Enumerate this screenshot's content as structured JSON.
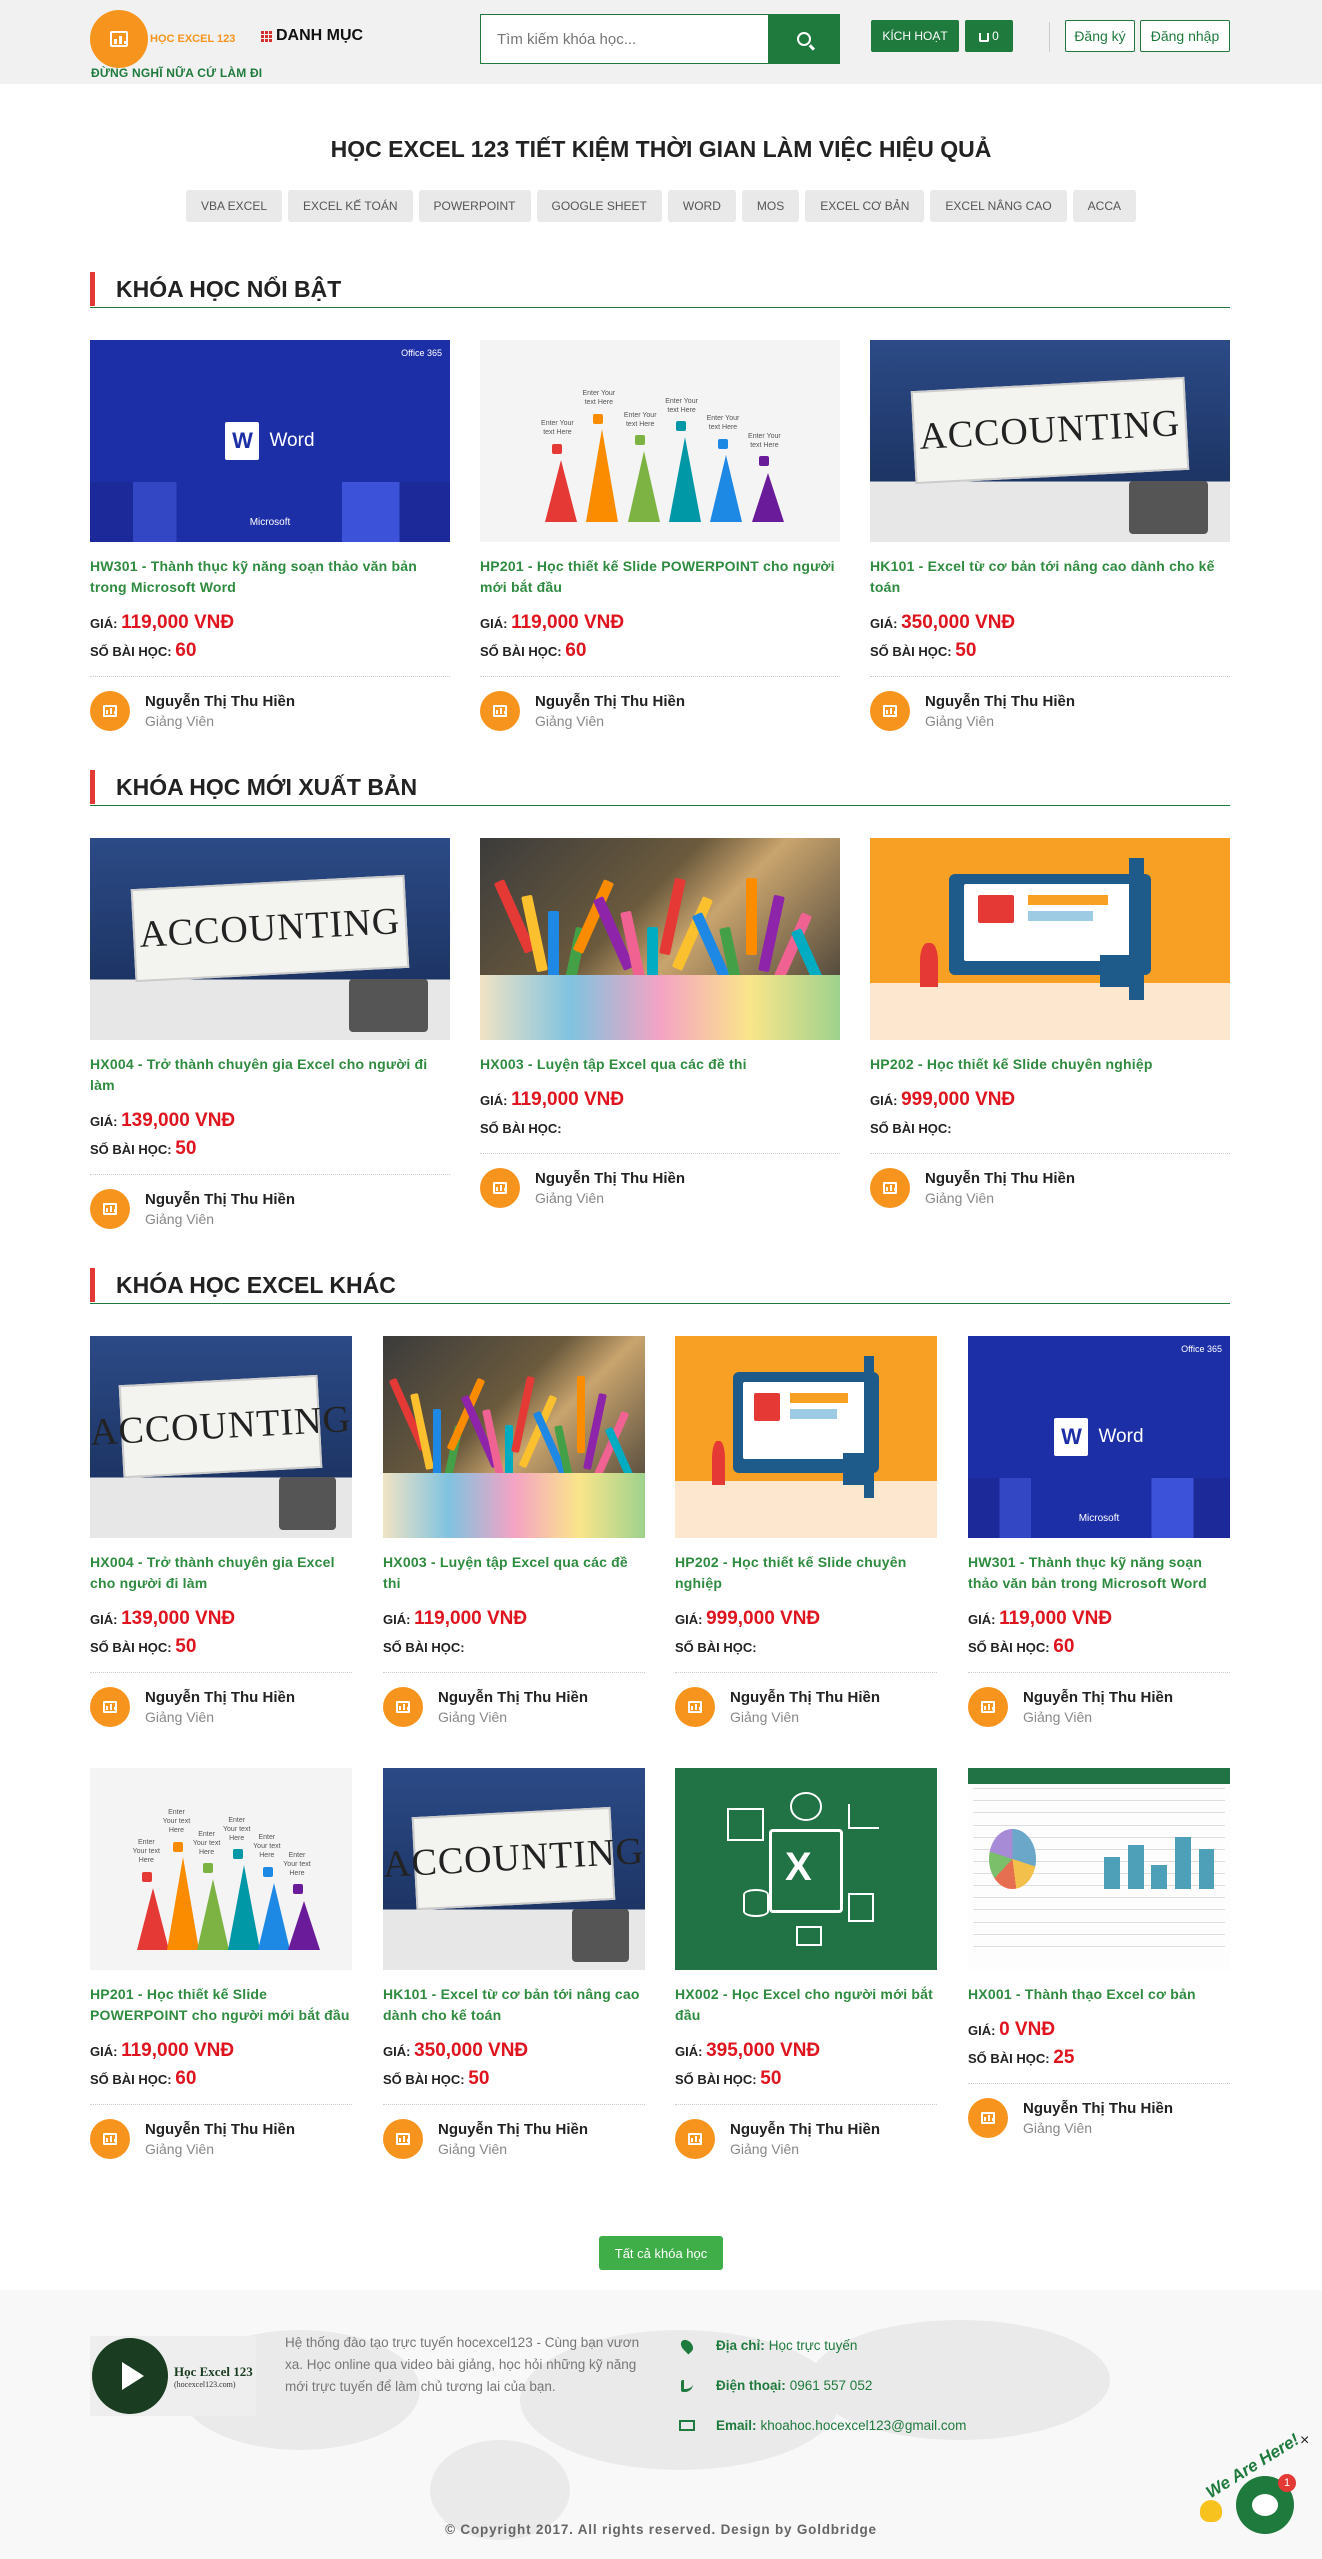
{
  "header": {
    "logo_text": "HỌC EXCEL 123",
    "slogan": "ĐỪNG NGHĨ NỮA CỨ LÀM ĐI",
    "menu_label": "DANH MỤC",
    "search_placeholder": "Tìm kiếm khóa học...",
    "activate_label": "KÍCH HOẠT",
    "cart_count": "0",
    "register_label": "Đăng ký",
    "login_label": "Đăng nhập"
  },
  "hero": {
    "title": "HỌC EXCEL 123 TIẾT KIỆM THỜI GIAN LÀM VIỆC HIỆU QUẢ",
    "tags": [
      "VBA EXCEL",
      "EXCEL KẾ TOÁN",
      "POWERPOINT",
      "GOOGLE SHEET",
      "WORD",
      "MOS",
      "EXCEL CƠ BẢN",
      "EXCEL NÂNG CAO",
      "ACCA"
    ]
  },
  "labels": {
    "price": "GIÁ:",
    "lessons": "SỐ BÀI HỌC:",
    "role": "Giảng Viên",
    "teacher": "Nguyễn Thị Thu Hiền"
  },
  "sections": [
    {
      "title": "KHÓA HỌC NỔI BẬT",
      "courses": [
        {
          "thumb": "word",
          "title": "HW301 - Thành thục kỹ năng soạn thảo văn bản trong Microsoft Word",
          "price": "119,000 VNĐ",
          "lessons": "60"
        },
        {
          "thumb": "bright",
          "title": "HP201 - Học thiết kế Slide POWERPOINT cho người mới bắt đầu",
          "price": "119,000 VNĐ",
          "lessons": "60"
        },
        {
          "thumb": "accounting",
          "title": "HK101 - Excel từ cơ bản tới nâng cao dành cho kế toán",
          "price": "350,000 VNĐ",
          "lessons": "50"
        }
      ]
    },
    {
      "title": "KHÓA HỌC MỚI XUẤT BẢN",
      "courses": [
        {
          "thumb": "accounting",
          "title": "HX004 - Trở thành chuyên gia Excel cho người đi làm",
          "price": "139,000 VNĐ",
          "lessons": "50"
        },
        {
          "thumb": "desk",
          "title": "HX003 - Luyện tập Excel qua các đề thi",
          "price": "119,000 VNĐ",
          "lessons": ""
        },
        {
          "thumb": "slide",
          "title": "HP202 - Học thiết kế Slide chuyên nghiệp",
          "price": "999,000 VNĐ",
          "lessons": ""
        }
      ]
    },
    {
      "title": "KHÓA HỌC EXCEL KHÁC",
      "courses": [
        {
          "thumb": "accounting",
          "title": "HX004 - Trở thành chuyên gia Excel cho người đi làm",
          "price": "139,000 VNĐ",
          "lessons": "50"
        },
        {
          "thumb": "desk",
          "title": "HX003 - Luyện tập Excel qua các đề thi",
          "price": "119,000 VNĐ",
          "lessons": ""
        },
        {
          "thumb": "slide",
          "title": "HP202 - Học thiết kế Slide chuyên nghiệp",
          "price": "999,000 VNĐ",
          "lessons": ""
        },
        {
          "thumb": "word",
          "title": "HW301 - Thành thục kỹ năng soạn thảo văn bản trong Microsoft Word",
          "price": "119,000 VNĐ",
          "lessons": "60"
        },
        {
          "thumb": "bright",
          "title": "HP201 - Học thiết kế Slide POWERPOINT cho người mới bắt đầu",
          "price": "119,000 VNĐ",
          "lessons": "60"
        },
        {
          "thumb": "accounting",
          "title": "HK101 - Excel từ cơ bản tới nâng cao dành cho kế toán",
          "price": "350,000 VNĐ",
          "lessons": "50"
        },
        {
          "thumb": "excel",
          "title": "HX002 - Học Excel cho người mới bắt đầu",
          "price": "395,000 VNĐ",
          "lessons": "50"
        },
        {
          "thumb": "sheet",
          "title": "HX001 - Thành thạo Excel cơ bản",
          "price": "0 VNĐ",
          "lessons": "25"
        }
      ]
    }
  ],
  "thumb_text": {
    "accounting": "ACCOUNTING",
    "word": "Word",
    "microsoft": "Microsoft",
    "office365": "Office 365",
    "enter_text": "Enter Your text Here"
  },
  "all_courses_label": "Tất cả khóa học",
  "footer": {
    "logo_text": "Học Excel 123",
    "logo_sub": "(hocexcel123.com)",
    "description": "Hệ thống đào tạo trực tuyến hocexcel123 - Cùng bạn vươn xa. Học online qua video bài giảng, học hỏi những kỹ năng mới trực tuyến để làm chủ tương lai của bạn.",
    "address_label": "Địa chỉ:",
    "address": "Học trực tuyến",
    "phone_label": "Điện thoại:",
    "phone": "0961 557 052",
    "email_label": "Email:",
    "email": "khoahoc.hocexcel123@gmail.com",
    "copyright": "© Copyright 2017. All rights reserved. Design by Goldbridge"
  },
  "chat": {
    "label": "We Are Here!",
    "badge": "1",
    "close": "×"
  },
  "colors": {
    "brand_green": "#1f7a3d",
    "accent_orange": "#f7941d",
    "price_red": "#e0141e",
    "heading_bar_red": "#e53935"
  }
}
